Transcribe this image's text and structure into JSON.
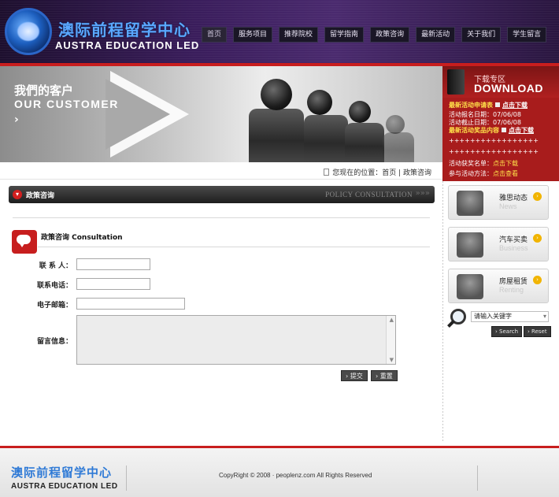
{
  "header": {
    "logo_cn": "澳际前程留学中心",
    "logo_en": "AUSTRA EDUCATION LED",
    "nav": [
      {
        "label": "首页"
      },
      {
        "label": "服务项目"
      },
      {
        "label": "推荐院校"
      },
      {
        "label": "留学指南"
      },
      {
        "label": "政策咨询"
      },
      {
        "label": "最新活动"
      },
      {
        "label": "关于我们"
      },
      {
        "label": "学生留言"
      }
    ]
  },
  "banner": {
    "title_cn": "我們的客户",
    "title_en": "OUR CUSTOMER",
    "arrow": "›"
  },
  "breadcrumb": {
    "text": "您现在的位置：首页  | 政策咨询"
  },
  "section": {
    "title": "政策咨询",
    "title_en": "POLICY CONSULTATION",
    "arrows": "»»»"
  },
  "form": {
    "title": "政策咨询  Consultation",
    "fields": [
      {
        "label": "联 系 人："
      },
      {
        "label": "联系电话："
      },
      {
        "label": "电子邮箱："
      },
      {
        "label": "留言信息："
      }
    ],
    "submit_label": "› 提交",
    "reset_label": "› 重置"
  },
  "download": {
    "head_cn": "下载专区",
    "head_en": "DOWNLOAD",
    "lines": [
      {
        "hl": "最新活动申请表",
        "link": "点击下载"
      },
      {
        "text": "活动报名日期：07/06/08"
      },
      {
        "text": "活动截止日期：07/06/08"
      },
      {
        "hl": "最新活动奖品内容",
        "link": "点击下载"
      },
      {
        "text": "+++++++++++++++++"
      },
      {
        "text": "+++++++++++++++++"
      },
      {
        "text": "活动获奖名单：",
        "link": "点击下载"
      },
      {
        "text": "参与活动方法：",
        "link": "点击查看"
      }
    ]
  },
  "side": [
    {
      "cn": "雅思动态",
      "en": "News"
    },
    {
      "cn": "汽车买卖",
      "en": "Business"
    },
    {
      "cn": "房屋租赁",
      "en": "Renting"
    }
  ],
  "search": {
    "placeholder": "请输入关键字",
    "search_label": "› Search",
    "reset_label": "› Reset"
  },
  "footer": {
    "logo_cn": "澳际前程留学中心",
    "logo_en": "AUSTRA EDUCATION LED",
    "copyright": "CopyRight © 2008 ·  peoplenz.com    All Rights Reserved"
  },
  "colors": {
    "accent_red": "#c81e1e",
    "header_purple": "#3a1d5c",
    "download_red": "#a81c1c",
    "link_yellow": "#ffe04a"
  }
}
